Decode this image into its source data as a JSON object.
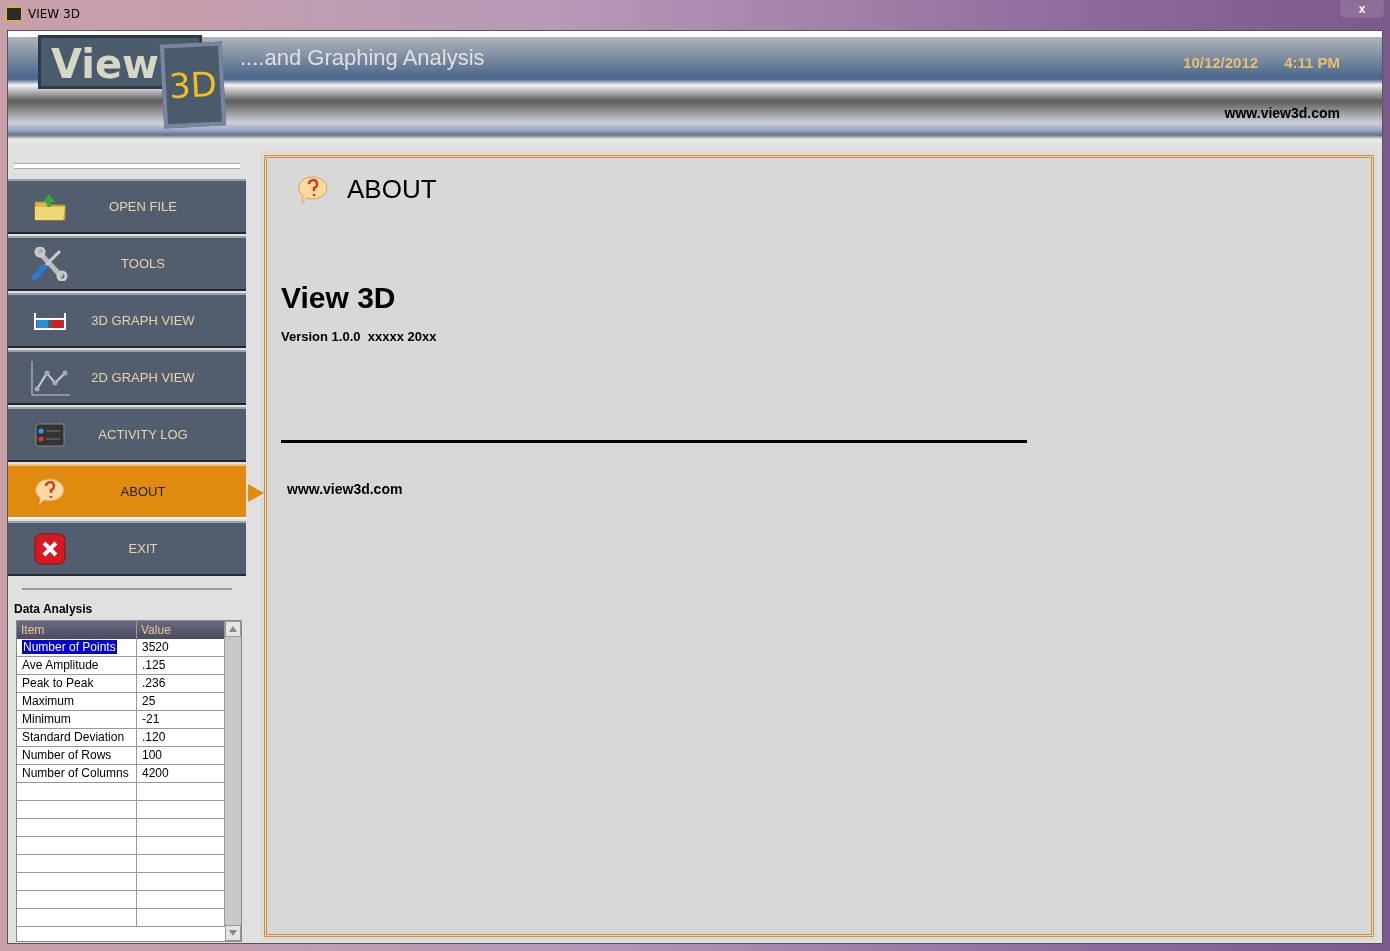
{
  "window": {
    "title": "VIEW 3D",
    "close": "x"
  },
  "header": {
    "logo_word": "View",
    "logo_badge": "3D",
    "tagline": "....and Graphing Analysis",
    "date": "10/12/2012",
    "time": "4:11 PM",
    "website": "www.view3d.com"
  },
  "sidebar": {
    "items": [
      {
        "label": "OPEN FILE",
        "kind": "folder",
        "selected": false
      },
      {
        "label": "TOOLS",
        "kind": "tools",
        "selected": false
      },
      {
        "label": "3D GRAPH VIEW",
        "kind": "glasses",
        "selected": false
      },
      {
        "label": "2D GRAPH VIEW",
        "kind": "chart",
        "selected": false
      },
      {
        "label": "ACTIVITY LOG",
        "kind": "log",
        "selected": false
      },
      {
        "label": "ABOUT",
        "kind": "help",
        "selected": true
      },
      {
        "label": "EXIT",
        "kind": "exit",
        "selected": false
      }
    ]
  },
  "data_analysis": {
    "title": "Data Analysis",
    "columns": [
      "Item",
      "Value"
    ],
    "rows": [
      {
        "item": "Number of Points",
        "value": "3520",
        "selected": true
      },
      {
        "item": "Ave Amplitude",
        "value": ".125",
        "selected": false
      },
      {
        "item": "Peak to Peak",
        "value": ".236",
        "selected": false
      },
      {
        "item": "Maximum",
        "value": "25",
        "selected": false
      },
      {
        "item": "Minimum",
        "value": "-21",
        "selected": false
      },
      {
        "item": "Standard Deviation",
        "value": ".120",
        "selected": false
      },
      {
        "item": "Number of Rows",
        "value": "100",
        "selected": false
      },
      {
        "item": "Number of Columns",
        "value": "4200",
        "selected": false
      }
    ]
  },
  "about": {
    "heading": "ABOUT",
    "product": "View 3D",
    "version": "Version 1.0.0  xxxxx 20xx",
    "website": "www.view3d.com"
  }
}
